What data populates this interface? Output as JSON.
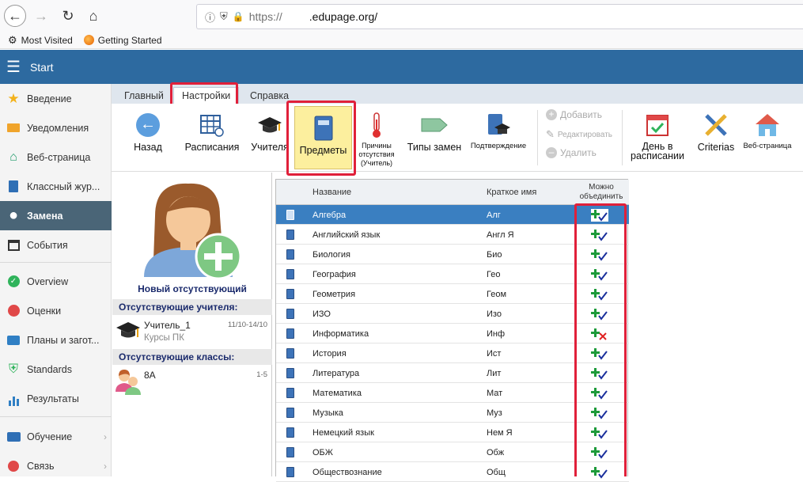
{
  "browser": {
    "url_proto": "https://",
    "url_host": ".edupage.org/",
    "bookmarks": [
      "Most Visited",
      "Getting Started"
    ]
  },
  "header": {
    "title": "Start"
  },
  "sidebar": {
    "items": [
      {
        "label": "Введение",
        "icon": "star-icon"
      },
      {
        "label": "Уведомления",
        "icon": "mail-icon"
      },
      {
        "label": "Веб-страница",
        "icon": "house-icon"
      },
      {
        "label": "Классный жур...",
        "icon": "journal-icon"
      },
      {
        "label": "Замена",
        "icon": "person-icon"
      },
      {
        "label": "События",
        "icon": "calendar-icon"
      },
      {
        "label": "Overview",
        "icon": "check-circle-icon"
      },
      {
        "label": "Оценки",
        "icon": "grades-icon"
      },
      {
        "label": "Планы и загот...",
        "icon": "briefcase-icon"
      },
      {
        "label": "Standards",
        "icon": "shield-icon"
      },
      {
        "label": "Результаты",
        "icon": "bar-chart-icon"
      },
      {
        "label": "Обучение",
        "icon": "book-icon"
      },
      {
        "label": "Связь",
        "icon": "chat-icon"
      }
    ]
  },
  "tabs": [
    "Главный",
    "Настройки",
    "Справка"
  ],
  "ribbon": {
    "back": "Назад",
    "timetable": "Расписания",
    "teachers": "Учителя",
    "subjects": "Предметы",
    "reasons_1": "Причины",
    "reasons_2": "отсутствия",
    "reasons_3": "(Учитель)",
    "sub_types": "Типы замен",
    "confirm": "Подтверждение",
    "add": "Добавить",
    "edit": "Редактировать",
    "delete": "Удалить",
    "day_1": "День в",
    "day_2": "расписании",
    "criterias": "Criterias",
    "webpage": "Веб-страница"
  },
  "absent": {
    "new_label": "Новый отсутствующий",
    "teachers_head": "Отсутствующие учителя:",
    "teacher_name": "Учитель_1",
    "teacher_dates": "11/10-14/10",
    "teacher_course": "Курсы ПК",
    "classes_head": "Отсутствующие классы:",
    "class_name": "8А",
    "class_periods": "1-5"
  },
  "table": {
    "col_name": "Название",
    "col_short": "Краткое имя",
    "col_merge_1": "Можно",
    "col_merge_2": "объединить",
    "rows": [
      {
        "name": "Алгебра",
        "short": "Алг",
        "merge": true
      },
      {
        "name": "Английский язык",
        "short": "Англ Я",
        "merge": true
      },
      {
        "name": "Биология",
        "short": "Био",
        "merge": true
      },
      {
        "name": "География",
        "short": "Гео",
        "merge": true
      },
      {
        "name": "Геометрия",
        "short": "Геом",
        "merge": true
      },
      {
        "name": "ИЗО",
        "short": "Изо",
        "merge": true
      },
      {
        "name": "Информатика",
        "short": "Инф",
        "merge": false
      },
      {
        "name": "История",
        "short": "Ист",
        "merge": true
      },
      {
        "name": "Литература",
        "short": "Лит",
        "merge": true
      },
      {
        "name": "Математика",
        "short": "Мат",
        "merge": true
      },
      {
        "name": "Музыка",
        "short": "Муз",
        "merge": true
      },
      {
        "name": "Немецкий язык",
        "short": "Нем Я",
        "merge": true
      },
      {
        "name": "ОБЖ",
        "short": "Обж",
        "merge": true
      },
      {
        "name": "Обществознание",
        "short": "Общ",
        "merge": true
      }
    ]
  },
  "colors": {
    "header": "#2d6aa0",
    "selected_row": "#3a7fc1",
    "highlight": "#e0203a",
    "active_sidebar": "#4a6577"
  }
}
